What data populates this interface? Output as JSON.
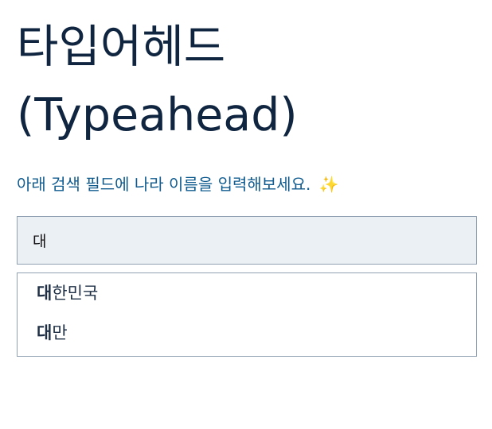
{
  "page": {
    "title_line1": "타입어헤드",
    "title_line2": "(Typeahead)",
    "subtitle": "아래 검색 필드에 나라 이름을 입력해보세요.",
    "subtitle_emoji": "✨"
  },
  "search": {
    "value": "대"
  },
  "suggestions": [
    {
      "match": "대",
      "rest": "한민국"
    },
    {
      "match": "대",
      "rest": "만"
    }
  ],
  "colors": {
    "title": "#0f2540",
    "subtitle": "#0f5b8f",
    "input_bg": "#ebf0f5",
    "border": "#8fa1b3"
  }
}
